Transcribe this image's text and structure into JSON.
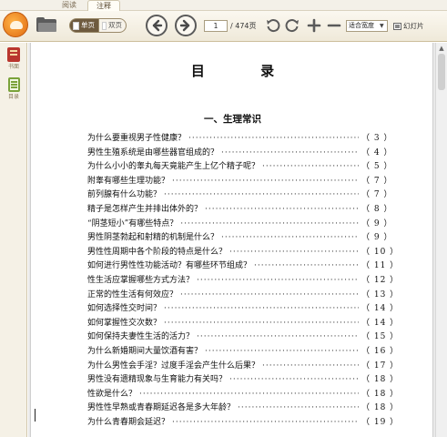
{
  "tabs": [
    {
      "label": "阅读"
    },
    {
      "label": "注释"
    }
  ],
  "toolbar": {
    "logo_icon": "reader-logo-icon",
    "open_icon": "folder-icon",
    "view_single_label": "单页",
    "view_double_label": "双页",
    "prev_icon": "arrow-left-icon",
    "next_icon": "arrow-right-icon",
    "page_current": "1",
    "page_total": "/ 474页",
    "rotate_left_icon": "rotate-left-icon",
    "rotate_right_icon": "rotate-right-icon",
    "zoom_in_icon": "plus-icon",
    "zoom_out_icon": "minus-icon",
    "fit_option": "适合宽度",
    "slideshow_label": "幻灯片"
  },
  "sidebar": {
    "items": [
      {
        "label": "书面",
        "icon": "book-icon"
      },
      {
        "label": "目录",
        "icon": "toc-icon"
      }
    ]
  },
  "document": {
    "title": "目 录",
    "section": "一、生理常识",
    "entries": [
      {
        "title": "为什么要重视男子性健康？",
        "page": "（ 3 ）"
      },
      {
        "title": "男性生殖系统是由哪些器官组成的？",
        "page": "（ 4 ）"
      },
      {
        "title": "为什么小小的睾丸每天竟能产生上亿个精子呢？",
        "page": "（ 5 ）"
      },
      {
        "title": "附睾有哪些生理功能？",
        "page": "（ 7 ）"
      },
      {
        "title": "前列腺有什么功能？",
        "page": "（ 7 ）"
      },
      {
        "title": "精子是怎样产生并排出体外的？",
        "page": "（ 8 ）"
      },
      {
        "title": "“阴茎短小”有哪些特点？",
        "page": "（ 9 ）"
      },
      {
        "title": "男性阴茎勃起和射精的机制是什么？",
        "page": "（ 9 ）"
      },
      {
        "title": "男性性周期中各个阶段的特点是什么？",
        "page": "（ 10 ）"
      },
      {
        "title": "如何进行男性性功能活动？有哪些环节组成？",
        "page": "（ 11 ）"
      },
      {
        "title": "性生活应掌握哪些方式方法？",
        "page": "（ 12 ）"
      },
      {
        "title": "正常的性生活有何效应？",
        "page": "（ 13 ）"
      },
      {
        "title": "如何选择性交时间？",
        "page": "（ 14 ）"
      },
      {
        "title": "如何掌握性交次数？",
        "page": "（ 14 ）"
      },
      {
        "title": "如何保持夫妻性生活的活力？",
        "page": "（ 15 ）"
      },
      {
        "title": "为什么新婚期间大量饮酒有害？",
        "page": "（ 16 ）"
      },
      {
        "title": "为什么男性会手淫？过度手淫会产生什么后果？",
        "page": "（ 17 ）"
      },
      {
        "title": "男性没有遗精现象与生育能力有关吗？",
        "page": "（ 18 ）"
      },
      {
        "title": "性欲是什么？",
        "page": "（ 18 ）"
      },
      {
        "title": "男性性早熟或青春期延迟各是多大年龄？",
        "page": "（ 18 ）"
      },
      {
        "title": "为什么青春期会延迟？",
        "page": "（ 19 ）"
      }
    ]
  }
}
